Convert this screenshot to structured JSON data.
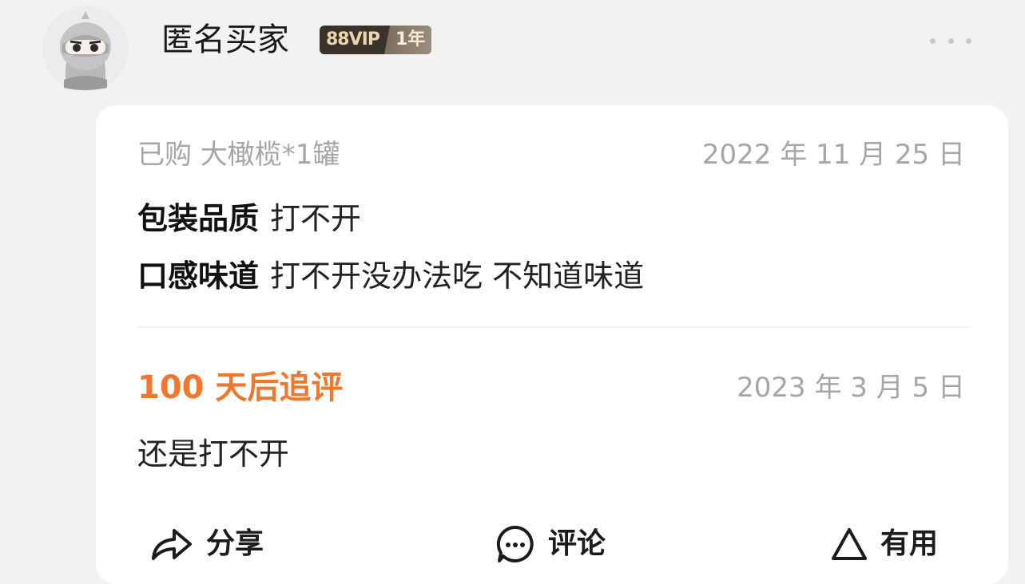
{
  "user": {
    "name": "匿名买家",
    "vip_label": "88VIP",
    "vip_years": "1年"
  },
  "review": {
    "purchase_info": "已购 大橄榄*1罐",
    "date": "2022 年 11 月 25 日",
    "lines": [
      {
        "key": "包装品质",
        "value": "打不开"
      },
      {
        "key": "口感味道",
        "value": "打不开没办法吃 不知道味道"
      }
    ]
  },
  "followup": {
    "title": "100 天后追评",
    "date": "2023 年 3 月 5 日",
    "text": "还是打不开"
  },
  "actions": {
    "share": "分享",
    "comment": "评论",
    "useful": "有用"
  },
  "colors": {
    "accent": "#f0772b",
    "background": "#f2f2f4",
    "card": "#ffffff",
    "muted_text": "#a6a6a6"
  },
  "icons": [
    "anonymous-avatar-icon",
    "more-icon",
    "share-icon",
    "comment-icon",
    "useful-icon"
  ]
}
